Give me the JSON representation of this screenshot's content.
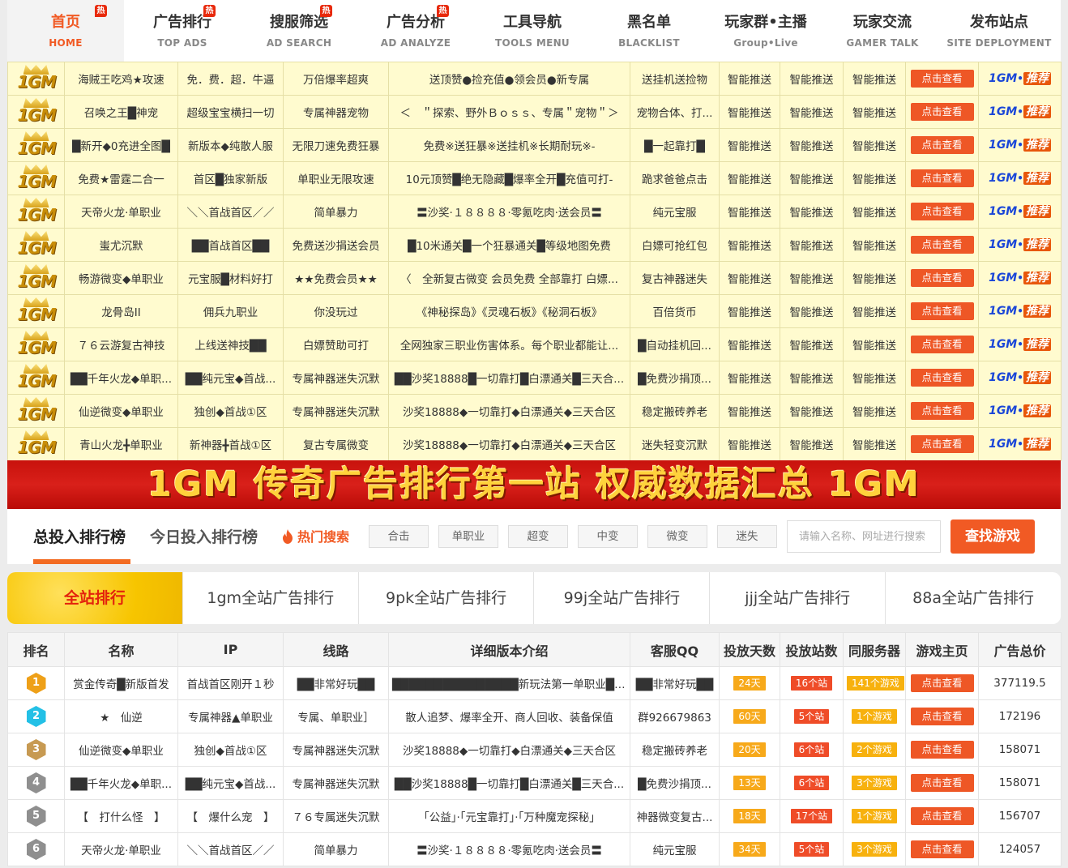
{
  "nav": [
    {
      "cn": "首页",
      "en": "HOME",
      "hot": "热",
      "active": true
    },
    {
      "cn": "广告排行",
      "en": "TOP ADS",
      "hot": "热",
      "active": false
    },
    {
      "cn": "搜服筛选",
      "en": "AD SEARCH",
      "hot": "热",
      "active": false
    },
    {
      "cn": "广告分析",
      "en": "AD ANALYZE",
      "hot": "热",
      "active": false
    },
    {
      "cn": "工具导航",
      "en": "TOOLS MENU",
      "hot": "",
      "active": false
    },
    {
      "cn": "黑名单",
      "en": "BLACKLIST",
      "hot": "",
      "active": false
    },
    {
      "cn": "玩家群•主播",
      "en": "Group•Live",
      "hot": "",
      "active": false
    },
    {
      "cn": "玩家交流",
      "en": "GAMER TALK",
      "hot": "",
      "active": false
    },
    {
      "cn": "发布站点",
      "en": "SITE DEPLOYMENT",
      "hot": "",
      "active": false
    }
  ],
  "promo": {
    "logo_text": "1GM",
    "smart_push": "智能推送",
    "view_button": "点击查看",
    "badge": {
      "a": "1GM",
      "b": "•",
      "c": "推荐"
    },
    "rows": [
      [
        "海贼王吃鸡★攻速",
        "免．费．超．牛逼",
        "万倍爆率超爽",
        "送顶赞●捡充值●领会员●新专属",
        "送挂机送捡物"
      ],
      [
        "召唤之王█神宠",
        "超级宝宝横扫一切",
        "专属神器宠物",
        "＜　＂探索、野外Ｂｏｓｓ、专属＂宠物＂＞",
        "宠物合体、打..."
      ],
      [
        "█新开◆0充进全图█",
        "新版本◆纯散人服",
        "无限刀速免费狂暴",
        "免费※送狂暴※送挂机※长期耐玩※-",
        "█一起靠打█"
      ],
      [
        "免费★雷霆二合一",
        "首区█独家新版",
        "单职业无限攻速",
        "10元顶赞█绝无隐藏█爆率全开█充值可打-",
        "跪求爸爸点击"
      ],
      [
        "天帝火龙·单职业",
        "＼＼首战首区／／",
        "简单暴力",
        "〓沙奖·１８８８８·零氪吃肉·送会员〓",
        "纯元宝服"
      ],
      [
        "蚩尤沉默",
        "██首战首区██",
        "免费送沙捐送会员",
        "█10米通关█一个狂暴通关█等级地图免费",
        "白嫖可抢红包"
      ],
      [
        "畅游微变◆单职业",
        "元宝服█材料好打",
        "★★免费会员★★",
        "〈　全新复古微变 会员免费 全部靠打 白嫖...",
        "复古神器迷失"
      ],
      [
        "龙骨岛II",
        "佣兵九职业",
        "你没玩过",
        "《神秘探岛》《灵魂石板》《秘洞石板》",
        "百倍货币"
      ],
      [
        "７６云游复古神技",
        "上线送神技██",
        "白嫖赞助可打",
        "全网独家三职业伤害体系。每个职业都能让...",
        "█自动挂机回..."
      ],
      [
        "██千年火龙◆单职...",
        "██纯元宝◆首战...",
        "专属神器迷失沉默",
        "██沙奖18888█一切靠打█白漂通关█三天合...",
        "█免费沙捐顶..."
      ],
      [
        "仙逆微变◆单职业",
        "独创◆首战①区",
        "专属神器迷失沉默",
        "沙奖18888◆一切靠打◆白漂通关◆三天合区",
        "稳定搬砖养老"
      ],
      [
        "青山火龙╋单职业",
        "新神器╋首战①区",
        "复古专属微变",
        "沙奖18888◆一切靠打◆白漂通关◆三天合区",
        "迷失轻变沉默"
      ]
    ]
  },
  "banner": {
    "text": "1GM 传奇广告排行第一站 权威数据汇总 1GM"
  },
  "search": {
    "tab_total": "总投入排行榜",
    "tab_today": "今日投入排行榜",
    "hot_label": "热门搜索",
    "tags": [
      "合击",
      "单职业",
      "超变",
      "中变",
      "微变",
      "迷失"
    ],
    "placeholder": "请输入名称、网址进行搜索",
    "button": "查找游戏"
  },
  "rank_tabs": [
    "全站排行",
    "1gm全站广告排行",
    "9pk全站广告排行",
    "99j全站广告排行",
    "jjj全站广告排行",
    "88a全站广告排行"
  ],
  "rank_table": {
    "headers": [
      "排名",
      "名称",
      "IP",
      "线路",
      "详细版本介绍",
      "客服QQ",
      "投放天数",
      "投放站数",
      "同服务器",
      "游戏主页",
      "广告总价"
    ],
    "view_button": "点击查看",
    "rank_colors": [
      "#eea018",
      "#23c0e6",
      "#c79a52",
      "#8f8f8f",
      "#8f8f8f",
      "#8f8f8f"
    ],
    "rows": [
      {
        "rank": "1",
        "name": "赏金传奇█新版首发",
        "ip": "首战首区刚开１秒",
        "line": "██非常好玩██",
        "intro": "███████████████新玩法第一单职业████...",
        "qq": "██非常好玩██",
        "days": "24天",
        "sites": "16个站",
        "same": "141个游戏",
        "total": "377119.5"
      },
      {
        "rank": "2",
        "name": "★　仙逆",
        "ip": "专属神器▲单职业",
        "line": "专属、单职业］",
        "intro": "散人追梦、爆率全开、商人回收、装备保值",
        "qq": "群926679863",
        "days": "60天",
        "sites": "5个站",
        "same": "1个游戏",
        "total": "172196"
      },
      {
        "rank": "3",
        "name": "仙逆微变◆单职业",
        "ip": "独创◆首战①区",
        "line": "专属神器迷失沉默",
        "intro": "沙奖18888◆一切靠打◆白漂通关◆三天合区",
        "qq": "稳定搬砖养老",
        "days": "20天",
        "sites": "6个站",
        "same": "2个游戏",
        "total": "158071"
      },
      {
        "rank": "4",
        "name": "██千年火龙◆单职...",
        "ip": "██纯元宝◆首战...",
        "line": "专属神器迷失沉默",
        "intro": "██沙奖18888█一切靠打█白漂通关█三天合...",
        "qq": "█免费沙捐顶...",
        "days": "13天",
        "sites": "6个站",
        "same": "3个游戏",
        "total": "158071"
      },
      {
        "rank": "5",
        "name": "【　打什么怪　】",
        "ip": "【　爆什么宠　】",
        "line": "７６专属迷失沉默",
        "intro": "「公益」·「元宝靠打」·「万种魔宠探秘」",
        "qq": "神器微变复古...",
        "days": "18天",
        "sites": "17个站",
        "same": "1个游戏",
        "total": "156707"
      },
      {
        "rank": "6",
        "name": "天帝火龙·单职业",
        "ip": "＼＼首战首区／／",
        "line": "简单暴力",
        "intro": "〓沙奖·１８８８８·零氪吃肉·送会员〓",
        "qq": "纯元宝服",
        "days": "34天",
        "sites": "5个站",
        "same": "3个游戏",
        "total": "124057"
      }
    ]
  }
}
